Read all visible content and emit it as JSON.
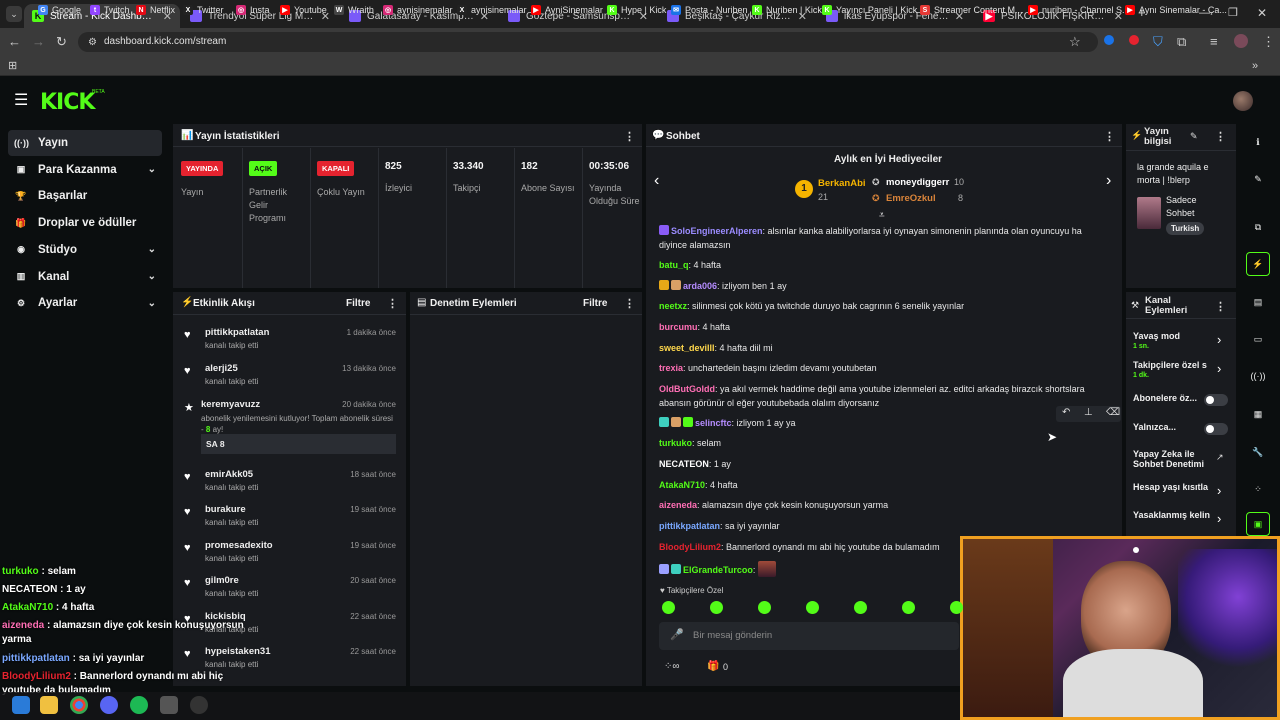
{
  "browser": {
    "tabs": [
      {
        "title": "Stream - Kick Dashboard",
        "active": true,
        "fav_color": "#53fc18",
        "fav_text": "K"
      },
      {
        "title": "Trendyol Süper Lig Maç Özetleri",
        "active": false,
        "fav_color": "#7a5af8",
        "fav_text": ""
      },
      {
        "title": "Galatasaray - Kasımpaşa Maç Özeti",
        "active": false,
        "fav_color": "#7a5af8",
        "fav_text": ""
      },
      {
        "title": "Göztepe - Samsunspor Maç Özeti",
        "active": false,
        "fav_color": "#7a5af8",
        "fav_text": ""
      },
      {
        "title": "Beşiktaş - Çaykur Rizespor Maç Özeti",
        "active": false,
        "fav_color": "#7a5af8",
        "fav_text": ""
      },
      {
        "title": "ikas Eyüpspor - Fenerbahçe Maç",
        "active": false,
        "fav_color": "#7a5af8",
        "fav_text": ""
      },
      {
        "title": "PSİKOLOJİK FIŞKIRTMA (ÖZET",
        "active": false,
        "fav_color": "#ff0033",
        "fav_text": "▶"
      }
    ],
    "url": "dashboard.kick.com/stream",
    "bookmarks": [
      {
        "label": "Google",
        "color": "#4285f4",
        "glyph": "G"
      },
      {
        "label": "Twitch",
        "color": "#9146ff",
        "glyph": "t"
      },
      {
        "label": "Netflix",
        "color": "#e50914",
        "glyph": "N"
      },
      {
        "label": "Twitter",
        "color": "#222222",
        "glyph": "X"
      },
      {
        "label": "Insta",
        "color": "#d62976",
        "glyph": "◎"
      },
      {
        "label": "Youtube",
        "color": "#ff0000",
        "glyph": "▶"
      },
      {
        "label": "Wraith",
        "color": "#444444",
        "glyph": "W"
      },
      {
        "label": "aynisinemalar",
        "color": "#d62976",
        "glyph": "◎"
      },
      {
        "label": "aynisinemalar",
        "color": "#222222",
        "glyph": "X"
      },
      {
        "label": "AyniSinemalar",
        "color": "#ff0000",
        "glyph": "▶"
      },
      {
        "label": "Hype | Kick",
        "color": "#53fc18",
        "glyph": "K"
      },
      {
        "label": "Posta - Nuriben",
        "color": "#1a73e8",
        "glyph": "✉"
      },
      {
        "label": "Nuriben | Kick",
        "color": "#53fc18",
        "glyph": "K"
      },
      {
        "label": "Yayıncı Paneli | Kick",
        "color": "#53fc18",
        "glyph": "K"
      },
      {
        "label": "Streamer Content M...",
        "color": "#e53935",
        "glyph": "S"
      },
      {
        "label": "nuriben - Channel S...",
        "color": "#ff0000",
        "glyph": "▶"
      },
      {
        "label": "Aynı Sinemalar - Ça...",
        "color": "#ff0000",
        "glyph": "▶"
      }
    ]
  },
  "sidebar": {
    "items": [
      {
        "label": "Yayın",
        "icon": "broadcast-icon",
        "glyph": "((·))",
        "active": true,
        "chevron": false
      },
      {
        "label": "Para Kazanma",
        "icon": "money-icon",
        "glyph": "▣",
        "active": false,
        "chevron": true
      },
      {
        "label": "Başarılar",
        "icon": "trophy-icon",
        "glyph": "🏆",
        "active": false,
        "chevron": false
      },
      {
        "label": "Droplar ve ödüller",
        "icon": "gift-icon",
        "glyph": "🎁",
        "active": false,
        "chevron": false
      },
      {
        "label": "Stüdyo",
        "icon": "studio-icon",
        "glyph": "◉",
        "active": false,
        "chevron": true
      },
      {
        "label": "Kanal",
        "icon": "channel-icon",
        "glyph": "▥",
        "active": false,
        "chevron": true
      },
      {
        "label": "Ayarlar",
        "icon": "settings-icon",
        "glyph": "⚙",
        "active": false,
        "chevron": true
      }
    ]
  },
  "stats": {
    "title": "Yayın İstatistikleri",
    "cols": [
      {
        "value": "YAYINDA",
        "label": "Yayın",
        "pill": "#e5232f",
        "pill_text": "#ffffff"
      },
      {
        "value": "AÇIK",
        "label": "Partnerlik Gelir Programı",
        "pill": "#53fc18",
        "pill_text": "#0b0e0f"
      },
      {
        "value": "KAPALI",
        "label": "Çoklu Yayın",
        "pill": "#e5232f",
        "pill_text": "#ffffff"
      },
      {
        "value": "825",
        "label": "İzleyici"
      },
      {
        "value": "33.340",
        "label": "Takipçi"
      },
      {
        "value": "182",
        "label": "Abone Sayısı"
      },
      {
        "value": "00:35:06",
        "label": "Yayında Olduğu Süre"
      }
    ]
  },
  "activity": {
    "title": "Etkinlik Akışı",
    "filter": "Filtre",
    "items": [
      {
        "name": "pittikkpatlatan",
        "time": "1 dakika önce",
        "sub": "kanalı takip etti"
      },
      {
        "name": "alerji25",
        "time": "13 dakika önce",
        "sub": "kanalı takip etti"
      },
      {
        "name": "keremyavuzz",
        "time": "20 dakika önce",
        "sub": "abonelik yenilemesini kutluyor! Toplam abonelik süresi - ",
        "months": "8",
        "sub_tail": " ay!",
        "message": "SA 8"
      },
      {
        "name": "emirAkk05",
        "time": "18 saat önce",
        "sub": "kanalı takip etti"
      },
      {
        "name": "burakure",
        "time": "19 saat önce",
        "sub": "kanalı takip etti"
      },
      {
        "name": "promesadexito",
        "time": "19 saat önce",
        "sub": "kanalı takip etti"
      },
      {
        "name": "gilm0re",
        "time": "20 saat önce",
        "sub": "kanalı takip etti"
      },
      {
        "name": "kickisbiq",
        "time": "22 saat önce",
        "sub": "kanalı takip etti"
      },
      {
        "name": "hypeistaken31",
        "time": "22 saat önce",
        "sub": "kanalı takip etti"
      }
    ]
  },
  "moderation": {
    "title": "Denetim Eylemleri",
    "filter": "Filtre"
  },
  "chat": {
    "title": "Sohbet",
    "gifters_title": "Aylık en İyi Hediyeciler",
    "gifters": [
      {
        "rank": "1",
        "name": "BerkanAbi",
        "count": "21"
      },
      {
        "name": "moneydiggerr",
        "count": "10"
      },
      {
        "name": "EmreOzkul",
        "count": "8"
      }
    ],
    "messages": [
      {
        "user": "SoloEngineerAlperen",
        "color": "#9b8cff",
        "text": "alsınlar kanka alabiliyorlarsa iyi oynayan simonenin planında olan oyuncuyu ha diyince alamazsın",
        "badges": [
          "#8a5cf6"
        ]
      },
      {
        "user": "batu_q",
        "color": "#53fc18",
        "text": "4 hafta",
        "badges": []
      },
      {
        "user": "arda006",
        "color": "#b58cff",
        "text": "izliyom ben 1 ay",
        "badges": [
          "#e6a817",
          "#d9a066"
        ]
      },
      {
        "user": "neetxz",
        "color": "#53fc18",
        "text": "silinmesi çok kötü ya twitchde duruyo bak cagrının 6 senelik yayınlar",
        "badges": []
      },
      {
        "user": "burcumu",
        "color": "#ff6fb5",
        "text": "4 hafta",
        "badges": []
      },
      {
        "user": "sweet_devilll",
        "color": "#ffd84d",
        "text": "4 hafta diil mi",
        "badges": []
      },
      {
        "user": "trexia",
        "color": "#ff6fb5",
        "text": "unchartedein başını izledim devamı youtubetan",
        "badges": []
      },
      {
        "user": "OldButGoldd",
        "color": "#ff6fb5",
        "text": "ya akıl vermek haddime değil ama youtube izlenmeleri az. editci arkadaş birazcık shortslara abansın görünür ol eğer youtubebada olalım diyorsanız",
        "badges": []
      },
      {
        "user": "selincftc",
        "color": "#b58cff",
        "text": "izliyom 1 ay ya",
        "badges": [
          "#3ecfbf",
          "#d9a066",
          "#53fc18"
        ]
      },
      {
        "user": "turkuko",
        "color": "#53fc18",
        "text": "selam",
        "badges": []
      },
      {
        "user": "NECATEON",
        "color": "#ffffff",
        "text": "1 ay",
        "badges": []
      },
      {
        "user": "AtakaN710",
        "color": "#53fc18",
        "text": "4 hafta",
        "badges": []
      },
      {
        "user": "aizeneda",
        "color": "#ff6fb5",
        "text": "alamazsın diye çok kesin konuşuyorsun yarma",
        "badges": []
      },
      {
        "user": "pittikkpatlatan",
        "color": "#7aa8ff",
        "text": "sa iyi yayınlar",
        "badges": []
      },
      {
        "user": "BloodyLilium2",
        "color": "#e5232f",
        "text": "Bannerlord oynandı mı abi hiç youtube da bulamadım",
        "badges": []
      },
      {
        "user": "ElGrandeTurcoo",
        "color": "#53fc18",
        "text": "",
        "badges": [
          "#9aa0ff",
          "#3ecfbf"
        ]
      }
    ],
    "followers_only": "Takipçilere Özel",
    "input_placeholder": "Bir mesaj gönderin",
    "footer_count": "0"
  },
  "stream_info": {
    "title": "Yayın bilgisi",
    "stream_title": "la grande aquila e morta | !blerp",
    "category": "Sadece Sohbet",
    "tag": "Turkish"
  },
  "channel_actions": {
    "title": "Kanal Eylemleri",
    "items": [
      {
        "label": "Yavaş mod",
        "sub": "1 sn.",
        "control": "chevron"
      },
      {
        "label": "Takipçilere özel s",
        "sub": "1 dk.",
        "control": "chevron"
      },
      {
        "label": "Abonelere öz...",
        "sub": "",
        "control": "toggle"
      },
      {
        "label": "Yalnızca...",
        "sub": "",
        "control": "toggle"
      },
      {
        "label": "Yapay Zeka ile Sohbet Denetimi",
        "sub": "",
        "control": "external"
      },
      {
        "label": "Hesap yaşı kısıtla",
        "sub": "",
        "control": "chevron"
      },
      {
        "label": "Yasaklanmış kelin",
        "sub": "",
        "control": "chevron"
      }
    ]
  },
  "overlay_chat": [
    {
      "user": "turkuko",
      "color": "#53fc18",
      "text": "selam"
    },
    {
      "user": "NECATEON",
      "color": "#ffffff",
      "text": "1 ay"
    },
    {
      "user": "AtakaN710",
      "color": "#53fc18",
      "text": "4 hafta"
    },
    {
      "user": "aizeneda",
      "color": "#ff6fb5",
      "text": "alamazsın diye çok kesin konuşuyorsun yarma"
    },
    {
      "user": "pittikkpatlatan",
      "color": "#7aa8ff",
      "text": "sa iyi yayınlar"
    },
    {
      "user": "BloodyLilium2",
      "color": "#e5232f",
      "text": "Bannerlord oynandı mı abi hiç youtube da bulamadım"
    }
  ],
  "colors": {
    "accent": "#53fc18",
    "panel": "#191b1f",
    "bg": "#0b0e0f",
    "live": "#e5232f"
  }
}
